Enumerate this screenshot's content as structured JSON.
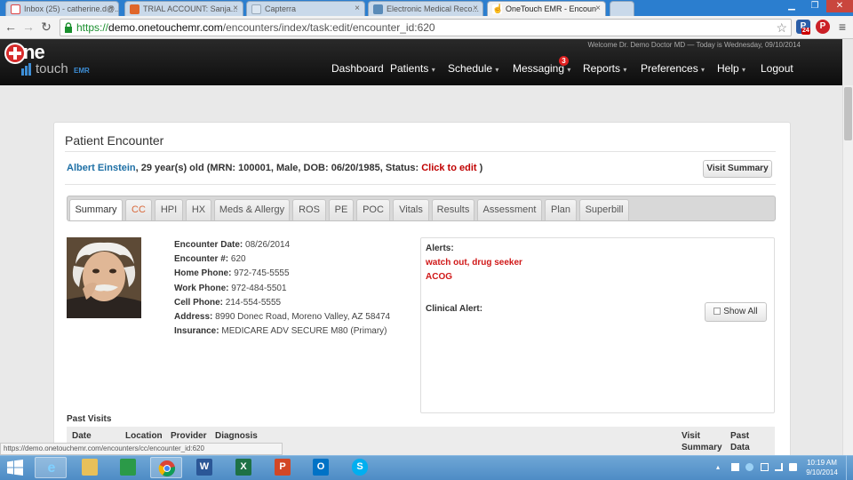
{
  "browser": {
    "tabs": [
      {
        "label": "Inbox (25) - catherine.d@..."
      },
      {
        "label": "TRIAL ACCOUNT: Sanja..."
      },
      {
        "label": "Capterra"
      },
      {
        "label": "Electronic Medical Reco..."
      },
      {
        "label": "OneTouch EMR - Encoun"
      }
    ],
    "url_scheme": "https://",
    "url_host": "demo.onetouchemr.com",
    "url_path": "/encounters/index/task:edit/encounter_id:620",
    "ext_badge": "24",
    "status_url": "https://demo.onetouchemr.com/encounters/cc/encounter_id:620"
  },
  "header": {
    "logo_one": "ne",
    "logo_touch": "touch",
    "logo_emr": "EMR",
    "welcome": "Welcome Dr. Demo Doctor MD — Today is Wednesday, 09/10/2014",
    "nav": [
      {
        "label": "Dashboard"
      },
      {
        "label": "Patients"
      },
      {
        "label": "Schedule"
      },
      {
        "label": "Messaging"
      },
      {
        "label": "Reports"
      },
      {
        "label": "Preferences"
      },
      {
        "label": "Help"
      },
      {
        "label": "Logout"
      }
    ],
    "messaging_badge": "3",
    "caret": "▾"
  },
  "encounter": {
    "title": "Patient Encounter",
    "patient_name": "Albert  Einstein",
    "patient_summary": ", 29 year(s) old (MRN: 100001, Male, DOB: 06/20/1985, Status: ",
    "status_link": "Click to edit",
    "close_paren": " )",
    "visit_summary_button": "Visit Summary",
    "tabs": [
      {
        "label": "Summary"
      },
      {
        "label": "CC"
      },
      {
        "label": "HPI"
      },
      {
        "label": "HX"
      },
      {
        "label": "Meds & Allergy"
      },
      {
        "label": "ROS"
      },
      {
        "label": "PE"
      },
      {
        "label": "POC"
      },
      {
        "label": "Vitals"
      },
      {
        "label": "Results"
      },
      {
        "label": "Assessment"
      },
      {
        "label": "Plan"
      },
      {
        "label": "Superbill"
      }
    ],
    "details": [
      {
        "label": "Encounter Date:",
        "value": "08/26/2014"
      },
      {
        "label": "Encounter #:",
        "value": "620"
      },
      {
        "label": "Home Phone:",
        "value": "972-745-5555"
      },
      {
        "label": "Work Phone:",
        "value": "972-484-5501"
      },
      {
        "label": "Cell Phone:",
        "value": "214-554-5555"
      },
      {
        "label": "Address:",
        "value": "8990 Donec Road, Moreno Valley, AZ 58474"
      },
      {
        "label": "Insurance:",
        "value": "MEDICARE ADV SECURE M80 (Primary)"
      }
    ],
    "alerts": {
      "label": "Alerts:",
      "items": [
        "watch out, drug seeker",
        "ACOG"
      ],
      "clinical_label": "Clinical Alert:",
      "show_all": "Show All"
    },
    "past_visits": {
      "title": "Past Visits",
      "columns": [
        "Date",
        "Location",
        "Provider",
        "Diagnosis"
      ],
      "col_visit_summary": [
        "Visit",
        "Summary"
      ],
      "col_past_data": [
        "Past",
        "Data"
      ]
    }
  },
  "taskbar": {
    "time": "10:19 AM",
    "date": "9/10/2014"
  }
}
